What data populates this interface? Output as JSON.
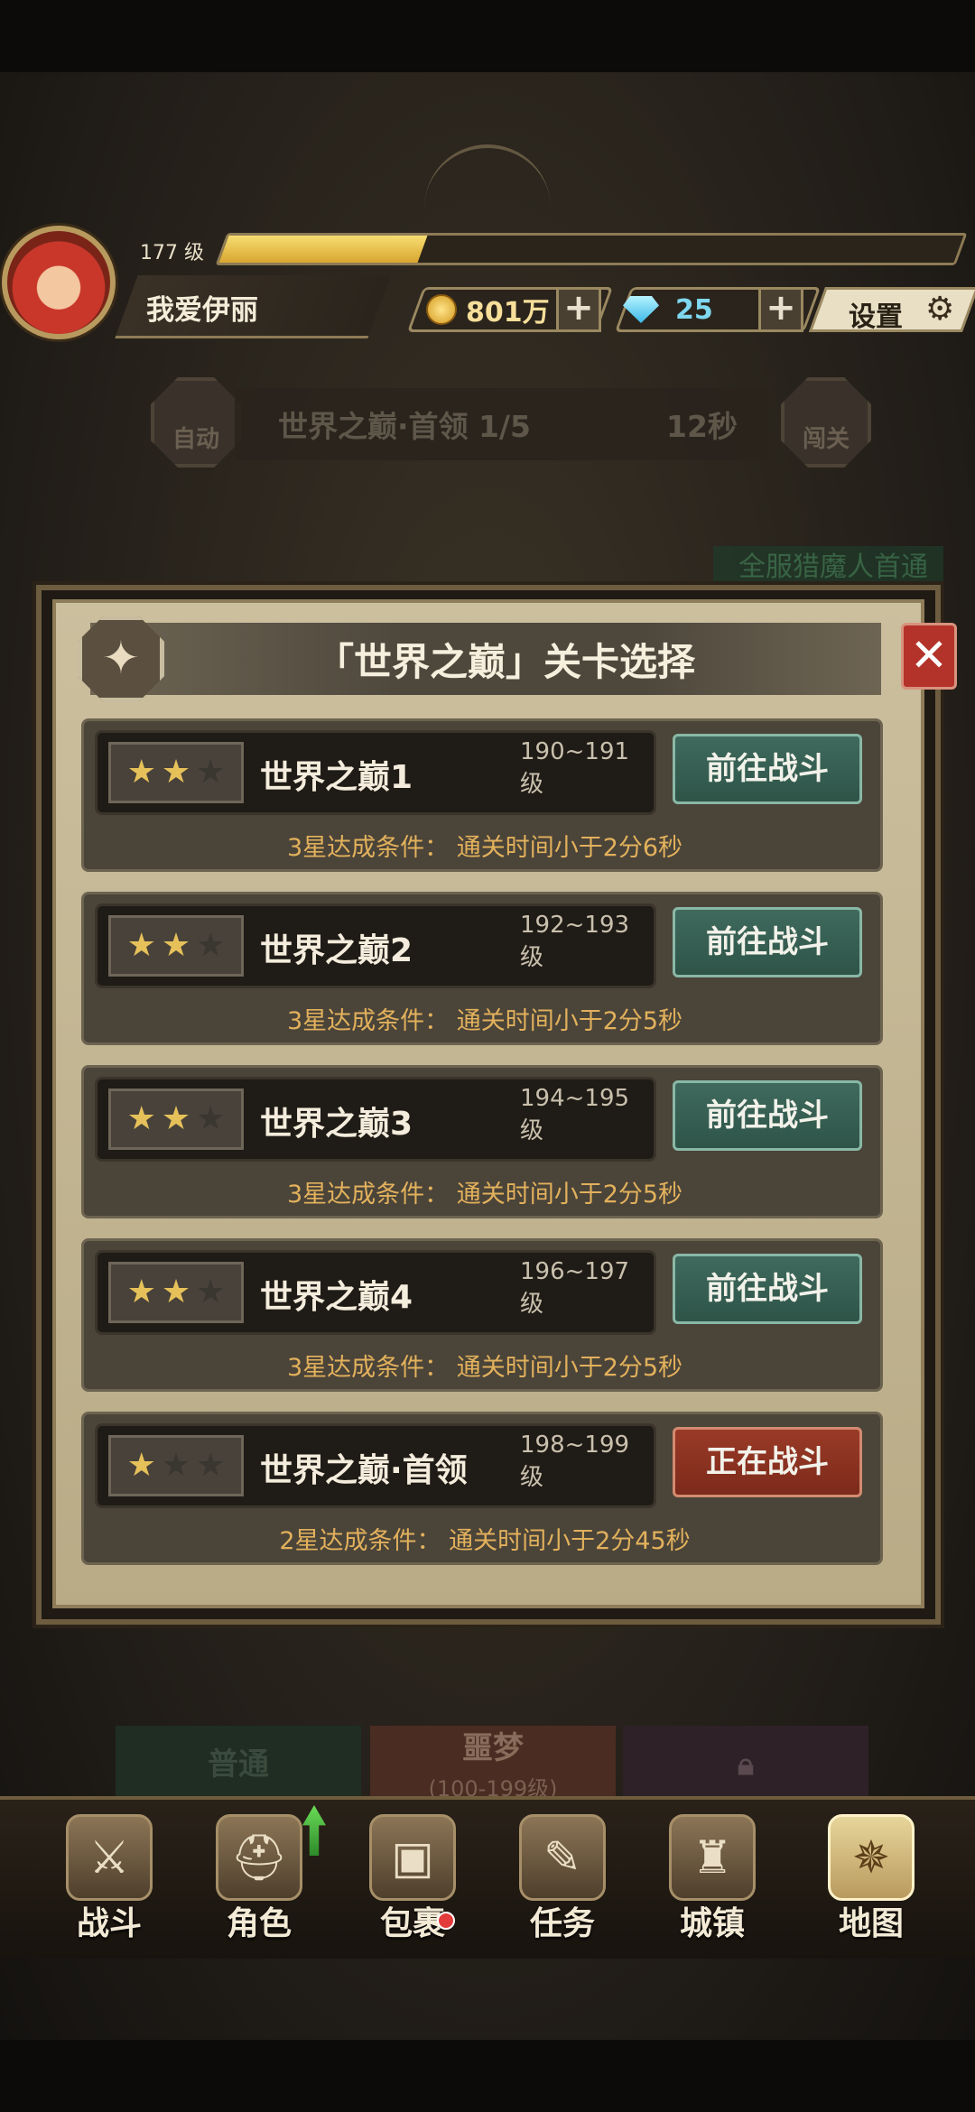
{
  "player": {
    "level": "177 级",
    "name": "我爱伊丽",
    "xp_fraction": 0.27
  },
  "currency": {
    "gold": "801万",
    "gems": "25",
    "plus": "+"
  },
  "settings_label": "设置",
  "battle_bar": {
    "auto_label": "自动",
    "boss_progress": "世界之巅·首领   1/5",
    "timer": "12秒",
    "challenge_label": "闯关"
  },
  "banner_text": "全服猎魔人首通",
  "modal": {
    "title": "「世界之巅」关卡选择",
    "close": "✕",
    "stages": [
      {
        "name": "世界之巅1",
        "level_range": "190~191 级",
        "stars": 2,
        "button": "前往战斗",
        "condition": "3星达成条件：  通关时间小于2分6秒",
        "active": false
      },
      {
        "name": "世界之巅2",
        "level_range": "192~193 级",
        "stars": 2,
        "button": "前往战斗",
        "condition": "3星达成条件：  通关时间小于2分5秒",
        "active": false
      },
      {
        "name": "世界之巅3",
        "level_range": "194~195 级",
        "stars": 2,
        "button": "前往战斗",
        "condition": "3星达成条件：  通关时间小于2分5秒",
        "active": false
      },
      {
        "name": "世界之巅4",
        "level_range": "196~197 级",
        "stars": 2,
        "button": "前往战斗",
        "condition": "3星达成条件：  通关时间小于2分5秒",
        "active": false
      },
      {
        "name": "世界之巅·首领",
        "level_range": "198~199 级",
        "stars": 1,
        "button": "正在战斗",
        "condition": "2星达成条件：  通关时间小于2分45秒",
        "active": true
      }
    ]
  },
  "difficulty_tabs": {
    "normal": "普通",
    "nightmare": "噩梦",
    "nightmare_sub": "(100-199级)"
  },
  "nav": [
    {
      "label": "战斗",
      "icon": "crossed-swords-icon",
      "glyph": "⚔"
    },
    {
      "label": "角色",
      "icon": "helmet-icon",
      "glyph": "⛑"
    },
    {
      "label": "包裹",
      "icon": "backpack-icon",
      "glyph": "▣"
    },
    {
      "label": "任务",
      "icon": "scroll-icon",
      "glyph": "✎"
    },
    {
      "label": "城镇",
      "icon": "tower-icon",
      "glyph": "♜"
    },
    {
      "label": "地图",
      "icon": "map-icon",
      "glyph": "✵"
    }
  ],
  "colors": {
    "accent_gold": "#e6c15a",
    "go_button": "#3f6a5d",
    "active_button": "#9a3a27",
    "condition_text": "#e2b15c"
  }
}
